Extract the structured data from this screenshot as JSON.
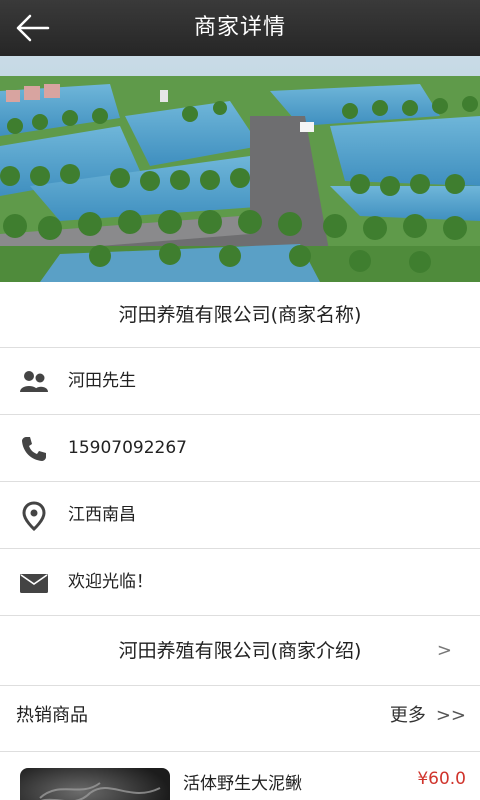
{
  "header": {
    "title": "商家详情"
  },
  "merchant": {
    "name": "河田养殖有限公司(商家名称)",
    "contact": "河田先生",
    "phone": "15907092267",
    "location": "江西南昌",
    "welcome": "欢迎光临！",
    "intro_link": "河田养殖有限公司(商家介绍)",
    "intro_chevron": ">"
  },
  "hot": {
    "title": "热销商品",
    "more_label": "更多",
    "more_arrows": ">>"
  },
  "products": [
    {
      "name": "活体野生大泥鳅",
      "price": "¥60.0"
    }
  ],
  "icons": {
    "back": "back-arrow-icon",
    "contact": "people-icon",
    "phone": "phone-icon",
    "location": "location-pin-icon",
    "message": "envelope-icon"
  },
  "colors": {
    "topbar": "#2e2e2e",
    "price": "#d0342c",
    "icon": "#444444"
  }
}
